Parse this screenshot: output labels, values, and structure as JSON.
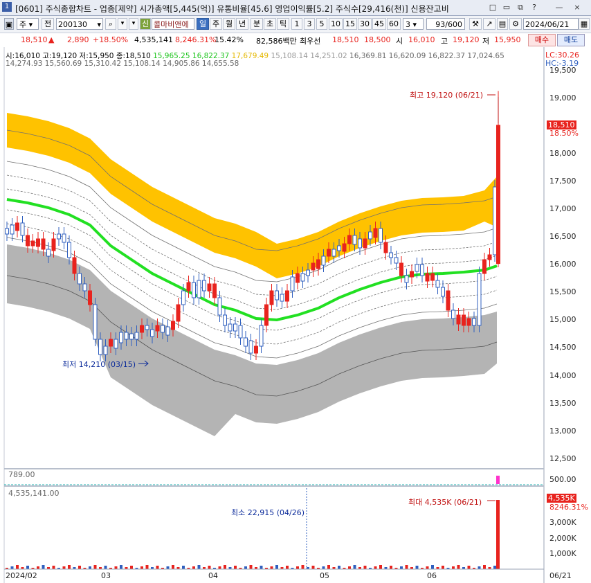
{
  "window": {
    "number": "1",
    "title": "[0601] 주식종합차트 - 업종[제약] 시가총액[5,445(억)] 유통비율[45.6] 영업이익률[5.2] 주식수[29,416(천)] 신용잔고비",
    "buttons": [
      "□",
      "▭",
      "⧉",
      "?",
      "—",
      "×"
    ]
  },
  "toolbar": {
    "type_select": "주",
    "prev_label": "전",
    "code_value": "200130",
    "credit_label": "신",
    "stock_name": "콜마비앤에",
    "period_tabs": [
      "일",
      "주",
      "월",
      "년",
      "분",
      "초",
      "틱"
    ],
    "active_period": "일",
    "interval_buttons": [
      "1",
      "3",
      "5",
      "10",
      "15",
      "30",
      "45",
      "60"
    ],
    "interval_value": "3",
    "count_display": "93/600",
    "date_value": "2024/06/21",
    "buy_label": "매수",
    "sell_label": "매도"
  },
  "pricebar": {
    "price": "18,510",
    "change_arrow": "▲",
    "change": "2,890",
    "change_pct": "+18.50%",
    "volume": "4,535,141",
    "volume_pct": "8,246.31%",
    "turnover": "15.42%",
    "amount": "82,586백만",
    "best_label": "최우선",
    "best_ask": "18,510",
    "best_bid": "18,500",
    "open_label": "시",
    "open": "16,010",
    "high_label": "고",
    "high": "19,120",
    "low_label": "저",
    "low": "15,950"
  },
  "legend": {
    "ohlc": "시:16,010 고:19,120 저:15,950 종:18,510",
    "green": "15,965.25 16,822.37",
    "yellow": "17,679.49",
    "grey1": "15,108.14 14,251.02",
    "grey2": "16,369.81 16,620.09 16,822.37 17,024.65",
    "line2_a": "14,274.93",
    "line2_b": "15,560.69 15,310.42 15,108.14 14,905.86 14,655.58",
    "lc": "LC:30.26",
    "hc": "HC:-3.19"
  },
  "price_axis": [
    "19,500",
    "19,000",
    "18,500",
    "18,000",
    "17,500",
    "17,000",
    "16,500",
    "16,000",
    "15,500",
    "15,000",
    "14,500",
    "14,000",
    "13,500",
    "13,000",
    "12,500"
  ],
  "annotations": {
    "high": "최고 19,120 (06/21)",
    "low": "최저 14,210 (03/15)",
    "last_price": "18,510",
    "last_pct": "18.50%",
    "vol_max": "최대 4,535K (06/21)",
    "vol_min": "최소 22,915 (04/26)",
    "vol_last": "4,535K",
    "vol_pct": "8246.31%"
  },
  "panel2": {
    "label": "789.00",
    "axis": "500.00"
  },
  "volume_panel": {
    "label": "4,535,141.00",
    "axis": [
      "3,000K",
      "2,000K",
      "1,000K"
    ]
  },
  "x_axis": {
    "labels": [
      "2024/02",
      "03",
      "04",
      "05",
      "06"
    ],
    "right": "06/21"
  },
  "colors": {
    "up": "#e8231e",
    "down": "#2f5fbf",
    "ma": "#22e022",
    "upper_band": "#ffc200",
    "lower_band": "#b4b4b4",
    "price_tag": "#e8231e"
  },
  "chart_data": {
    "type": "candlestick",
    "x_range": [
      "2024/02",
      "2024/06/21"
    ],
    "ylim": [
      12350,
      19600
    ],
    "last_candle": {
      "date": "06/21",
      "open": 16010,
      "high": 19120,
      "low": 15950,
      "close": 18510
    },
    "volume_max": 4535141
  }
}
